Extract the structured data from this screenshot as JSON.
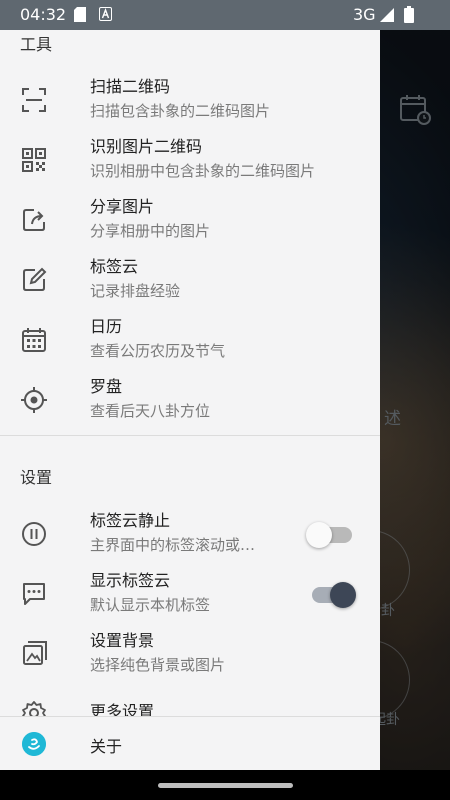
{
  "status_bar": {
    "time": "04:32",
    "network": "3G",
    "icons": [
      "sd-card-icon",
      "text-app-icon",
      "signal-icon",
      "battery-icon"
    ]
  },
  "background_app": {
    "partial_texts": [
      "述",
      "卦",
      "起卦"
    ],
    "icons": [
      "calendar-clock-icon"
    ]
  },
  "drawer": {
    "tools_section": {
      "title": "工具",
      "items": [
        {
          "title": "扫描二维码",
          "subtitle": "扫描包含卦象的二维码图片",
          "icon": "scan-frame-icon"
        },
        {
          "title": "识别图片二维码",
          "subtitle": "识别相册中包含卦象的二维码图片",
          "icon": "qr-code-icon"
        },
        {
          "title": "分享图片",
          "subtitle": "分享相册中的图片",
          "icon": "share-icon"
        },
        {
          "title": "标签云",
          "subtitle": "记录排盘经验",
          "icon": "edit-note-icon"
        },
        {
          "title": "日历",
          "subtitle": "查看公历农历及节气",
          "icon": "calendar-icon"
        },
        {
          "title": "罗盘",
          "subtitle": "查看后天八卦方位",
          "icon": "compass-target-icon"
        }
      ]
    },
    "settings_section": {
      "title": "设置",
      "items": [
        {
          "title": "标签云静止",
          "subtitle": "主界面中的标签滚动或…",
          "icon": "pause-circle-icon",
          "toggle": false
        },
        {
          "title": "显示标签云",
          "subtitle": "默认显示本机标签",
          "icon": "chat-bubble-icon",
          "toggle": true
        },
        {
          "title": "设置背景",
          "subtitle": "选择纯色背景或图片",
          "icon": "image-icon"
        },
        {
          "title": "更多设置",
          "subtitle": "",
          "icon": "gear-icon"
        }
      ]
    },
    "about": {
      "label": "关于",
      "icon": "app-logo-icon"
    }
  },
  "colors": {
    "drawer_bg": "#f4f4f5",
    "toggle_on_knob": "#3d4656",
    "toggle_on_track": "#a7adb6",
    "toggle_off_knob": "#fafafa",
    "toggle_off_track": "#b9b9b9",
    "about_icon": "#1fb8d6"
  }
}
